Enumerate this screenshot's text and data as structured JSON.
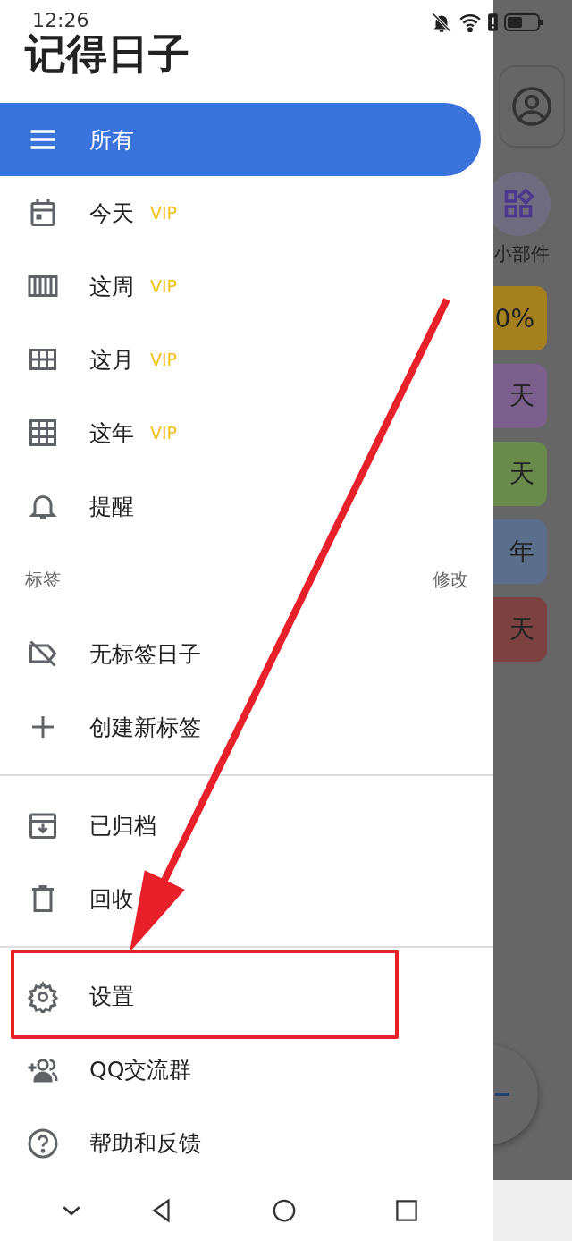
{
  "status_bar": {
    "time": "12:26"
  },
  "app_title": "记得日子",
  "drawer": {
    "primary_items": [
      {
        "label": "所有",
        "selected": true
      },
      {
        "label": "今天",
        "vip": "VIP",
        "selected": false
      },
      {
        "label": "这周",
        "vip": "VIP",
        "selected": false
      },
      {
        "label": "这月",
        "vip": "VIP",
        "selected": false
      },
      {
        "label": "这年",
        "vip": "VIP",
        "selected": false
      },
      {
        "label": "提醒",
        "selected": false
      }
    ],
    "tags_section": {
      "title": "标签",
      "action": "修改",
      "items": [
        {
          "label": "无标签日子"
        },
        {
          "label": "创建新标签"
        }
      ]
    },
    "secondary_items": [
      {
        "label": "已归档"
      },
      {
        "label": "回收"
      }
    ],
    "footer_items": [
      {
        "label": "设置"
      },
      {
        "label": "QQ交流群"
      },
      {
        "label": "帮助和反馈"
      }
    ]
  },
  "background": {
    "widget_label": "小部件",
    "cards": [
      {
        "text": "0%",
        "color": "#a5801f"
      },
      {
        "text": "天",
        "color": "#7b5f8c"
      },
      {
        "text": "天",
        "color": "#6a8a4c"
      },
      {
        "text": "年",
        "color": "#5b6f8c"
      },
      {
        "text": "天",
        "color": "#7c4242"
      }
    ]
  }
}
